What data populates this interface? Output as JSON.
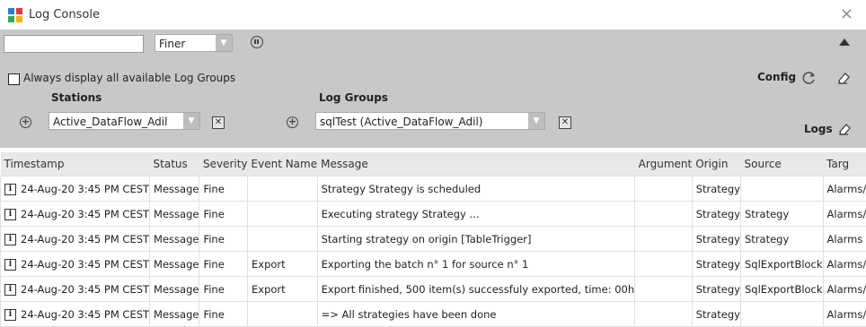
{
  "window": {
    "title": "Log Console",
    "close": "×"
  },
  "toolbar": {
    "filter_value": "",
    "level": "Finer",
    "always_display_label": "Always display all available Log Groups",
    "config_label": "Config",
    "logs_label": "Logs"
  },
  "stations": {
    "heading": "Stations",
    "selected": "Active_DataFlow_Adil"
  },
  "log_groups": {
    "heading": "Log Groups",
    "selected": "sqlTest (Active_DataFlow_Adil)"
  },
  "table": {
    "columns": [
      "Timestamp",
      "Status",
      "Severity",
      "Event Name",
      "Message",
      "Argument",
      "Origin",
      "Source",
      "Targ"
    ],
    "rows": [
      [
        "24-Aug-20 3:45 PM CEST",
        "Message",
        "Fine",
        "",
        "Strategy Strategy is scheduled",
        "",
        "Strategy",
        "",
        "Alarms/I"
      ],
      [
        "24-Aug-20 3:45 PM CEST",
        "Message",
        "Fine",
        "",
        "Executing strategy Strategy ...",
        "",
        "Strategy",
        "Strategy",
        "Alarms/I"
      ],
      [
        "24-Aug-20 3:45 PM CEST",
        "Message",
        "Fine",
        "",
        "Starting strategy on origin [TableTrigger]",
        "",
        "Strategy",
        "Strategy",
        "Alarms"
      ],
      [
        "24-Aug-20 3:45 PM CEST",
        "Message",
        "Fine",
        "Export",
        "Exporting the batch n° 1 for source n° 1",
        "",
        "Strategy",
        "SqlExportBlock",
        "Alarms/I"
      ],
      [
        "24-Aug-20 3:45 PM CEST",
        "Message",
        "Fine",
        "Export",
        "Export finished, 500 item(s) successfuly exported, time: 00h",
        "",
        "Strategy",
        "SqlExportBlock",
        "Alarms/I"
      ],
      [
        "24-Aug-20 3:45 PM CEST",
        "Message",
        "Fine",
        "",
        "=> All strategies have been done",
        "",
        "Strategy",
        "",
        "Alarms/I"
      ]
    ]
  }
}
